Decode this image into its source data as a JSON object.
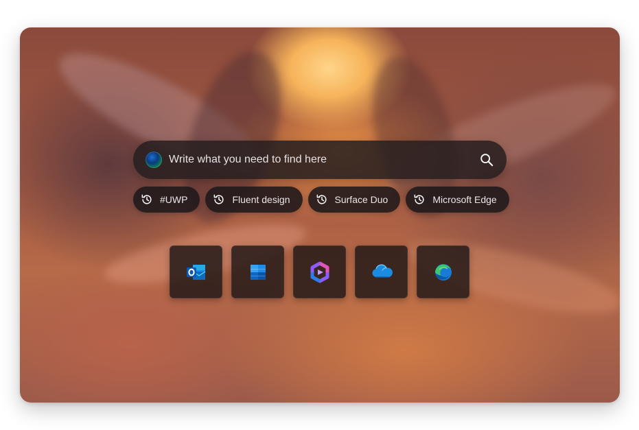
{
  "search": {
    "placeholder": "Write what you need to find here",
    "leading_icon": "copilot-orb-icon",
    "trailing_icon": "search-icon"
  },
  "recent_searches": [
    {
      "label": "#UWP",
      "icon": "history-icon"
    },
    {
      "label": "Fluent design",
      "icon": "history-icon"
    },
    {
      "label": "Surface Duo",
      "icon": "history-icon"
    },
    {
      "label": "Microsoft Edge",
      "icon": "history-icon"
    }
  ],
  "apps": [
    {
      "name": "Outlook",
      "icon": "outlook-icon"
    },
    {
      "name": "Microsoft Store",
      "icon": "store-icon"
    },
    {
      "name": "Microsoft 365",
      "icon": "m365-icon"
    },
    {
      "name": "OneDrive",
      "icon": "onedrive-icon"
    },
    {
      "name": "Edge",
      "icon": "edge-icon"
    }
  ],
  "colors": {
    "surface": "#261e20",
    "text": "#e8e3e3",
    "accent_blue": "#1b6ed4",
    "accent_green": "#22c27a"
  }
}
